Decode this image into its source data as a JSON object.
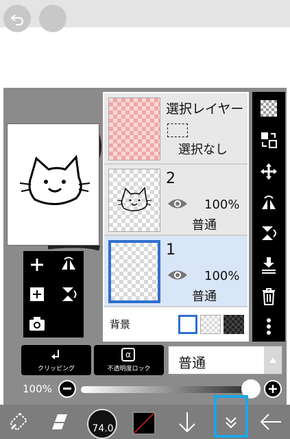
{
  "layers": [
    {
      "name": "選択レイヤー",
      "status": "選択なし",
      "thumbnail": "pink-checker"
    },
    {
      "name": "2",
      "opacity": "100%",
      "blend": "普通",
      "thumbnail": "cat-sketch"
    },
    {
      "name": "1",
      "opacity": "100%",
      "blend": "普通",
      "thumbnail": "empty",
      "selected": true
    }
  ],
  "background": {
    "label": "背景"
  },
  "buttons": {
    "clipping": "クリッピング",
    "alpha_lock": "不透明度ロック",
    "alpha_symbol": "α"
  },
  "blend_mode": {
    "value": "普通"
  },
  "opacity": {
    "label": "100%",
    "value_percent": 100
  },
  "bottom": {
    "brush_size": "74.0"
  },
  "colors": {
    "accent": "#1aa7e8",
    "selected_layer": "#d9e6f7",
    "selection_border": "#2f6fd0"
  },
  "icons": {
    "top": [
      "undo-icon",
      "redo-icon"
    ],
    "right": [
      "checker-icon",
      "transfer-icon",
      "move-icon",
      "flip-h-icon",
      "flip-v-icon",
      "merge-down-icon",
      "trash-icon",
      "more-icon"
    ],
    "left": [
      "add-icon",
      "flip-h-icon",
      "add-layer-icon",
      "flip-v-icon",
      "camera-icon"
    ],
    "bottom": [
      "transform-icon",
      "eraser-icon",
      "brush-size",
      "color-swatch",
      "down-arrow-icon",
      "collapse-icon",
      "back-icon"
    ]
  }
}
